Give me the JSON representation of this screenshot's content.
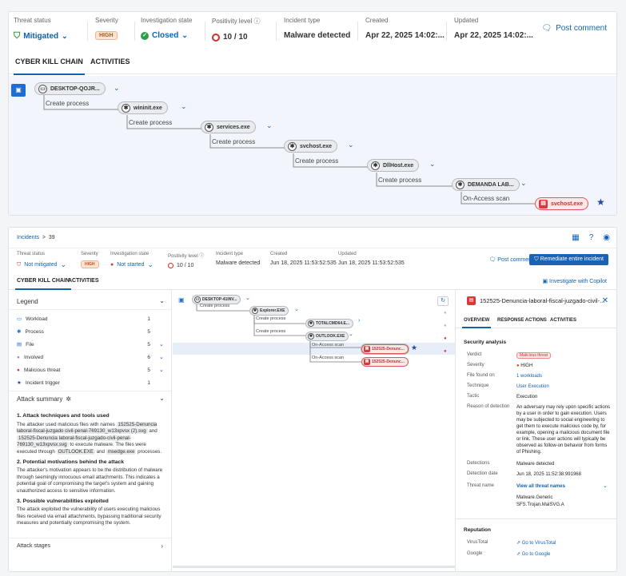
{
  "top": {
    "header": {
      "threat_status_label": "Threat status",
      "threat_status": "Mitigated",
      "severity_label": "Severity",
      "severity": "HIGH",
      "investigation_label": "Investigation state",
      "investigation": "Closed",
      "positivity_label": "Positivity level",
      "positivity": "10 / 10",
      "incident_type_label": "Incident type",
      "incident_type": "Malware detected",
      "created_label": "Created",
      "created": "Apr 22, 2025 14:02:...",
      "updated_label": "Updated",
      "updated": "Apr 22, 2025 14:02:...",
      "post_comment": "Post comment"
    },
    "tabs": [
      "CYBER KILL CHAIN",
      "ACTIVITIES"
    ],
    "chain": {
      "nodes": [
        "DESKTOP-QOJR...",
        "wininit.exe",
        "services.exe",
        "svchost.exe",
        "DllHost.exe",
        "DEMANDA LAB...",
        "svchost.exe"
      ],
      "edges": [
        "Create process",
        "Create process",
        "Create process",
        "Create process",
        "Create process",
        "On-Access scan"
      ]
    }
  },
  "bottom": {
    "breadcrumb": {
      "root": "Incidents",
      "sep": ">",
      "id": "39"
    },
    "header": {
      "threat_status_label": "Threat status",
      "threat_status": "Not mitigated",
      "severity_label": "Severity",
      "severity": "HIGH",
      "investigation_label": "Investigation state",
      "investigation": "Not started",
      "positivity_label": "Positivity level",
      "positivity": "10 / 10",
      "incident_type_label": "Incident type",
      "incident_type": "Malware detected",
      "created_label": "Created",
      "created": "Jun 18, 2025 11:53:52:535",
      "updated_label": "Updated",
      "updated": "Jun 18, 2025 11:53:52:535",
      "post_comment": "Post comment",
      "remediate": "Remediate entire incident"
    },
    "tabs": [
      "CYBER KILL CHAIN",
      "ACTIVITIES"
    ],
    "copilot": "Investigate with Copilot",
    "legend": {
      "title": "Legend",
      "items": [
        {
          "label": "Workload",
          "count": "1"
        },
        {
          "label": "Process",
          "count": "5"
        },
        {
          "label": "File",
          "count": "5"
        },
        {
          "label": "Involved",
          "count": "6"
        },
        {
          "label": "Malicious threat",
          "count": "5"
        },
        {
          "label": "Incident trigger",
          "count": "1"
        }
      ]
    },
    "attack_summary": {
      "title": "Attack summary",
      "h1": "1. Attack techniques and tools used",
      "p1a": "The attacker used malicious files with names",
      "chip1": "152525-Denuncia laboral-fiscal-juzgado civil-penal-769130_w13xpvsx (2).svg",
      "p1b": "and",
      "chip2": "152525-Denuncia laboral-fiscal-juzgado-civil-penal-769130_w13xpvsx.svg",
      "p1c": "to execute malware. The files were executed through",
      "chip3": "OUTLOOK.EXE",
      "p1d": "and",
      "chip4": "msedge.exe",
      "p1e": "processes.",
      "h2": "2. Potential motivations behind the attack",
      "p2": "The attacker's motivation appears to be the distribution of malware through seemingly innocuous email attachments. This indicates a potential goal of compromising the target's system and gaining unauthorized access to sensitive information.",
      "h3": "3. Possible vulnerabilities exploited",
      "p3": "The attack exploited the vulnerability of users executing malicious files received via email attachments, bypassing traditional security measures and potentially compromising the system."
    },
    "attack_stages": "Attack stages",
    "chain": {
      "nodes": [
        "DESKTOP-41INV...",
        "Explorer.EXE",
        "TOTALCMD64.E...",
        "OUTLOOK.EXE",
        "152525-Denunc...",
        "152525-Denunc..."
      ],
      "edges": [
        "Create process",
        "Create process",
        "Create process",
        "On-Access scan",
        "On-Access scan"
      ]
    },
    "details": {
      "title": "152525-Denuncia-laboral-fiscal-juzgado-civil-...",
      "tabs": [
        "OVERVIEW",
        "RESPONSE ACTIONS",
        "ACTIVITIES"
      ],
      "section": "Security analysis",
      "rows": {
        "verdict_k": "Verdict",
        "verdict": "Malicious threat",
        "severity_k": "Severity",
        "severity": "HIGH",
        "found_k": "File found on",
        "found": "1 workloads",
        "technique_k": "Technique",
        "technique": "User Execution",
        "tactic_k": "Tactic",
        "tactic": "Execution",
        "reason_k": "Reason of detection",
        "reason": "An adversary may rely upon specific actions by a user in order to gain execution. Users may be subjected to social engineering to get them to execute malicious code by, for example, opening a malicious document file or link. These user actions will typically be observed as follow-on behavior from forms of Phishing.",
        "detections_k": "Detections",
        "detections": "Malware detected",
        "date_k": "Detection date",
        "date": "Jun 18, 2025 11:52:38:991968",
        "threat_k": "Threat name",
        "threat_link": "View all threat names",
        "threat1": "Malware.Generic",
        "threat2": "SFS.Trojan.MalSVG.A"
      },
      "reputation": "Reputation",
      "vt_k": "VirusTotal",
      "vt": "Go to VirusTotal",
      "google_k": "Google",
      "google": "Go to Google"
    }
  },
  "colors": {
    "accent": "#0f62b0",
    "danger": "#d63a3a",
    "high": "#c4501b",
    "ok": "#2e9e48"
  }
}
